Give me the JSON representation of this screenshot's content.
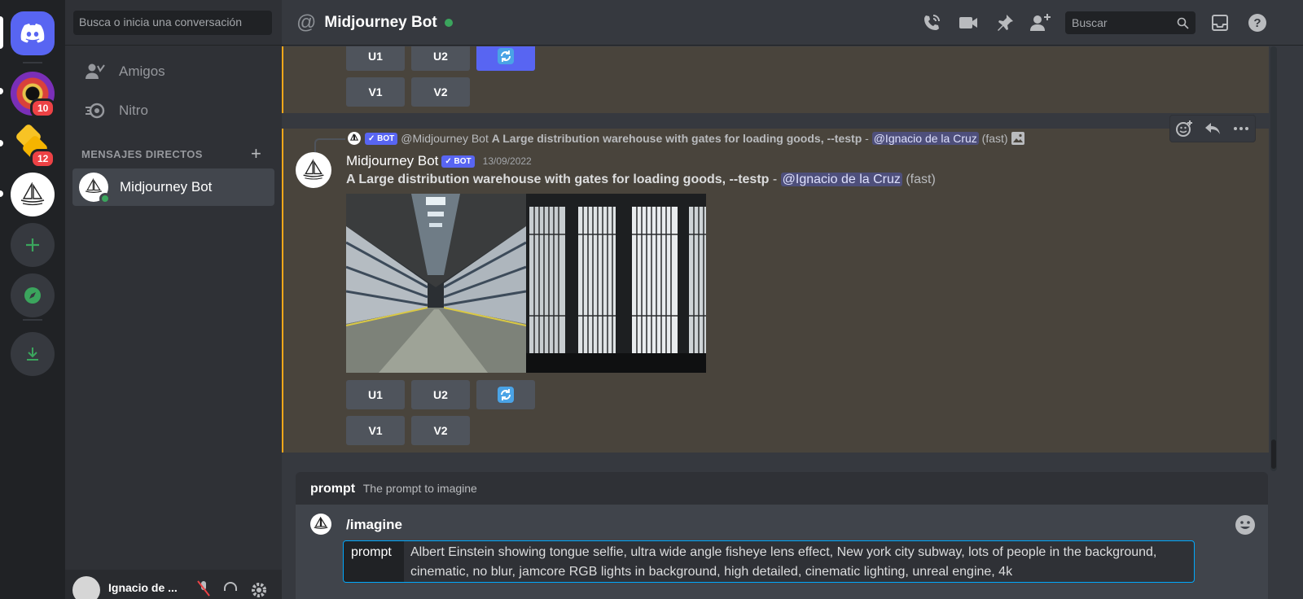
{
  "colors": {
    "blurple": "#5865f2",
    "online": "#3ba55d",
    "highlight_border": "#faa81a",
    "badge_red": "#ed4245"
  },
  "rail": {
    "servers": [
      {
        "name": "discord-home",
        "icon": "discord-logo-icon"
      },
      {
        "name": "server-eye",
        "badge": "10"
      },
      {
        "name": "server-yellow",
        "badge": "12"
      },
      {
        "name": "server-midjourney",
        "icon": "sailboat-icon"
      }
    ],
    "actions": [
      "add-server-icon",
      "explore-compass-icon",
      "download-icon"
    ]
  },
  "sidebar": {
    "search_placeholder": "Busca o inicia una conversación",
    "nav": [
      {
        "label": "Amigos",
        "icon": "friends-icon"
      },
      {
        "label": "Nitro",
        "icon": "nitro-icon"
      }
    ],
    "dm_header": "MENSAJES DIRECTOS",
    "dm_add": "+",
    "dms": [
      {
        "name": "Midjourney Bot",
        "status": "online"
      }
    ],
    "user": {
      "name": "Ignacio de ..."
    }
  },
  "header": {
    "title": "Midjourney Bot",
    "search_placeholder": "Buscar",
    "icons": [
      "call-icon",
      "video-icon",
      "pin-icon",
      "add-friend-icon",
      "search-icon",
      "inbox-icon",
      "help-icon"
    ]
  },
  "messages": {
    "prev_buttons": [
      "U1",
      "U2",
      "V1",
      "V2"
    ],
    "reply": {
      "bot_tag": "✓ BOT",
      "author": "@Midjourney Bot",
      "prompt": "A Large distribution warehouse with gates for loading goods, --testp",
      "sep": "-",
      "mention": "@Ignacio de la Cruz",
      "mode": "(fast)"
    },
    "main": {
      "author": "Midjourney Bot",
      "bot_tag": "✓ BOT",
      "timestamp": "13/09/2022",
      "prompt": "A Large distribution warehouse with gates for loading goods, --testp",
      "sep": "-",
      "mention": "@Ignacio de la Cruz",
      "mode": "(fast)",
      "buttons": [
        "U1",
        "U2",
        "V1",
        "V2"
      ]
    },
    "hover_toolbar": [
      "add-reaction-icon",
      "reply-icon",
      "more-icon"
    ]
  },
  "composer": {
    "option_name": "prompt",
    "option_desc": "The prompt to imagine",
    "command": "/imagine",
    "prompt_label": "prompt",
    "prompt_value": "Albert Einstein showing tongue selfie, ultra wide angle fisheye lens effect, New york city subway, lots of people in the background, cinematic, no blur, jamcore RGB lights in background, high detailed, cinematic lighting, unreal engine, 4k"
  }
}
